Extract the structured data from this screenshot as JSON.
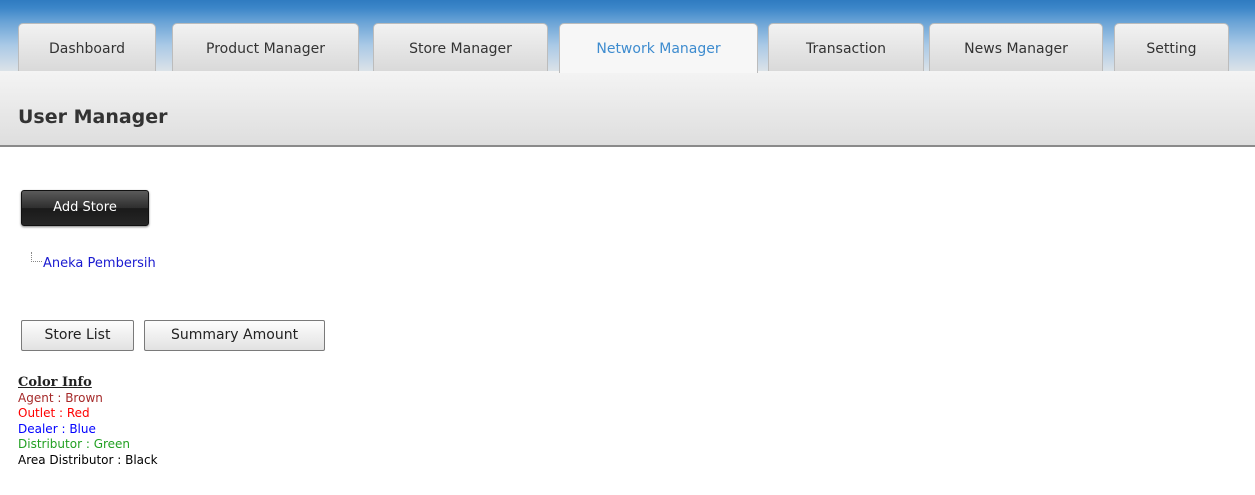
{
  "tabs": [
    {
      "label": "Dashboard",
      "active": false
    },
    {
      "label": "Product Manager",
      "active": false
    },
    {
      "label": "Store Manager",
      "active": false
    },
    {
      "label": "Network Manager",
      "active": true
    },
    {
      "label": "Transaction",
      "active": false
    },
    {
      "label": "News Manager",
      "active": false
    },
    {
      "label": "Setting",
      "active": false
    }
  ],
  "page": {
    "title": "User Manager"
  },
  "actions": {
    "add_store_label": "Add Store",
    "store_list_label": "Store List",
    "summary_amount_label": "Summary Amount"
  },
  "tree": {
    "items": [
      {
        "label": "Aneka Pembersih"
      }
    ]
  },
  "color_info": {
    "title": "Color Info",
    "lines": [
      {
        "role": "Agent",
        "color_name": "Brown",
        "color": "#a52a2a"
      },
      {
        "role": "Outlet",
        "color_name": "Red",
        "color": "#ff0000"
      },
      {
        "role": "Dealer",
        "color_name": "Blue",
        "color": "#0000ff"
      },
      {
        "role": "Distributor",
        "color_name": "Green",
        "color": "#22a022"
      },
      {
        "role": "Area Distributor",
        "color_name": "Black",
        "color": "#000000"
      }
    ]
  },
  "colors": {
    "active_tab_text": "#3e8ccf",
    "link": "#1a1ad0"
  }
}
